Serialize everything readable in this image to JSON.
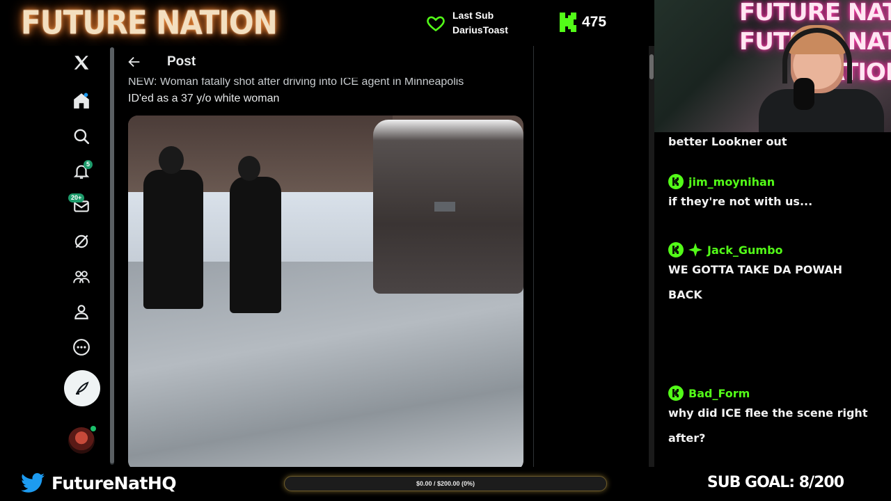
{
  "overlay": {
    "brand": "FUTURE NATION",
    "last_sub_label": "Last Sub",
    "last_sub_name": "DariusToast",
    "kick_followers": "475",
    "handle": "FutureNatHQ",
    "goal_text": "$0.00 / $200.00 (0%)",
    "goal_fraction": 0,
    "sub_goal": "SUB GOAL: 8/200",
    "accent_green": "#53fc18",
    "accent_gold": "#c8a23a"
  },
  "x_app": {
    "nav": {
      "notifications_badge": "5",
      "messages_badge": "20+"
    },
    "post": {
      "header_title": "Post",
      "text_line1": "NEW: Woman fatally shot after driving into ICE agent in Minneapolis",
      "text_line2": "ID'ed as a 37 y/o white woman"
    }
  },
  "cam": {
    "neon_lines": [
      "FUTURE NATION",
      "FUTURE NATION",
      "NATION"
    ]
  },
  "chat": {
    "messages": [
      {
        "user": "",
        "text": "better Lookner out"
      },
      {
        "user": "jim_moynihan",
        "text": "if they're not with us..."
      },
      {
        "user": "Jack_Gumbo",
        "text": "WE GOTTA TAKE DA POWAH",
        "text2": "BACK"
      },
      {
        "user": "Bad_Form",
        "text": "why did ICE flee the scene right",
        "text2": "after?"
      }
    ]
  }
}
